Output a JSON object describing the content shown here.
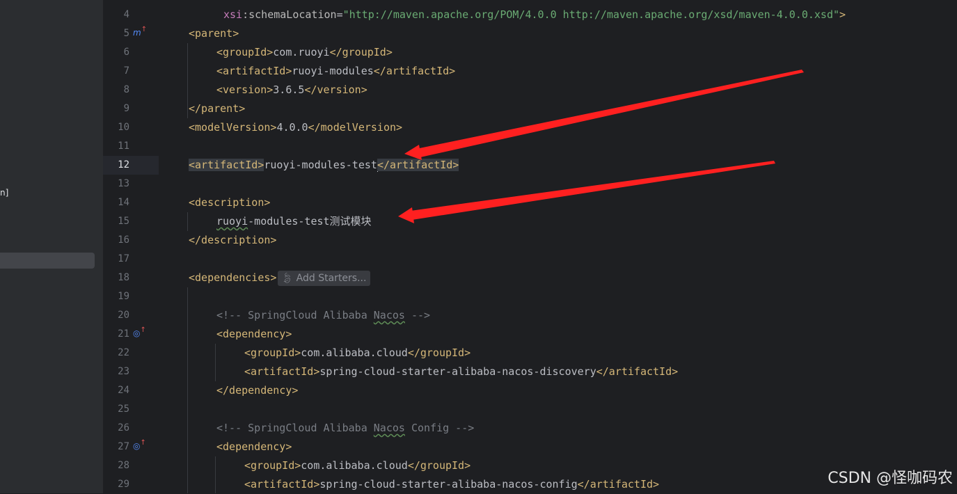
{
  "sidebar": {
    "fragment_text": "n]"
  },
  "gutter": {
    "icon_parent": "maven-parent-icon",
    "icon_dep1": "spring-dependency-icon",
    "icon_dep2": "spring-dependency-icon"
  },
  "lines": [
    {
      "n": "4",
      "text": ""
    },
    {
      "n": "5",
      "text": ""
    },
    {
      "n": "6",
      "text": ""
    },
    {
      "n": "7",
      "text": ""
    },
    {
      "n": "8",
      "text": ""
    },
    {
      "n": "9",
      "text": ""
    },
    {
      "n": "10",
      "text": ""
    },
    {
      "n": "11",
      "text": ""
    },
    {
      "n": "12",
      "text": ""
    },
    {
      "n": "13",
      "text": ""
    },
    {
      "n": "14",
      "text": ""
    },
    {
      "n": "15",
      "text": ""
    },
    {
      "n": "16",
      "text": ""
    },
    {
      "n": "17",
      "text": ""
    },
    {
      "n": "18",
      "text": ""
    },
    {
      "n": "19",
      "text": ""
    },
    {
      "n": "20",
      "text": ""
    },
    {
      "n": "21",
      "text": ""
    },
    {
      "n": "22",
      "text": ""
    },
    {
      "n": "23",
      "text": ""
    },
    {
      "n": "24",
      "text": ""
    },
    {
      "n": "25",
      "text": ""
    },
    {
      "n": "26",
      "text": ""
    },
    {
      "n": "27",
      "text": ""
    },
    {
      "n": "28",
      "text": ""
    },
    {
      "n": "29",
      "text": ""
    }
  ],
  "code": {
    "l0_ns": "xsi",
    "l0_attr": ":schemaLocation",
    "l0_eq": "=",
    "l0_str": "\"http://maven.apache.org/POM/4.0.0 http://maven.apache.org/xsd/maven-4.0.0.xsd\"",
    "l0_end": ">",
    "parent_open": "<parent>",
    "groupId_open": "<groupId>",
    "groupId_close": "</groupId>",
    "groupId_ruoyi": "com.ruoyi",
    "artifactId_open": "<artifactId>",
    "artifactId_close": "</artifactId>",
    "artifactId_modules": "ruoyi-modules",
    "version_open": "<version>",
    "version_val": "3.6.5",
    "version_close": "</version>",
    "parent_close": "</parent>",
    "modelVersion_open": "<modelVersion>",
    "modelVersion_val": "4.0.0",
    "modelVersion_close": "</modelVersion>",
    "artifactId_test_a": "ruoyi-modules-test",
    "description_open": "<description>",
    "description_word1": "ruoyi",
    "description_rest": "-modules-test测试模块",
    "description_close": "</description>",
    "dependencies_open": "<dependencies>",
    "add_starters": "Add Starters...",
    "cmt1_a": "<!-- SpringCloud Alibaba ",
    "cmt1_b": "Nacos",
    "cmt1_c": " -->",
    "dependency_open": "<dependency>",
    "groupId_alibaba": "com.alibaba.cloud",
    "artifactId_discovery": "spring-cloud-starter-alibaba-nacos-discovery",
    "dependency_close": "</dependency>",
    "cmt2_a": "<!-- SpringCloud Alibaba ",
    "cmt2_b": "Nacos",
    "cmt2_c": " Config -->",
    "artifactId_config": "spring-cloud-starter-alibaba-nacos-config"
  },
  "watermark": "CSDN @怪咖码农",
  "colors": {
    "background": "#1e1f22",
    "tag": "#d5b778",
    "string": "#6aab73",
    "comment": "#7a7e85",
    "arrow": "#ff2020"
  }
}
